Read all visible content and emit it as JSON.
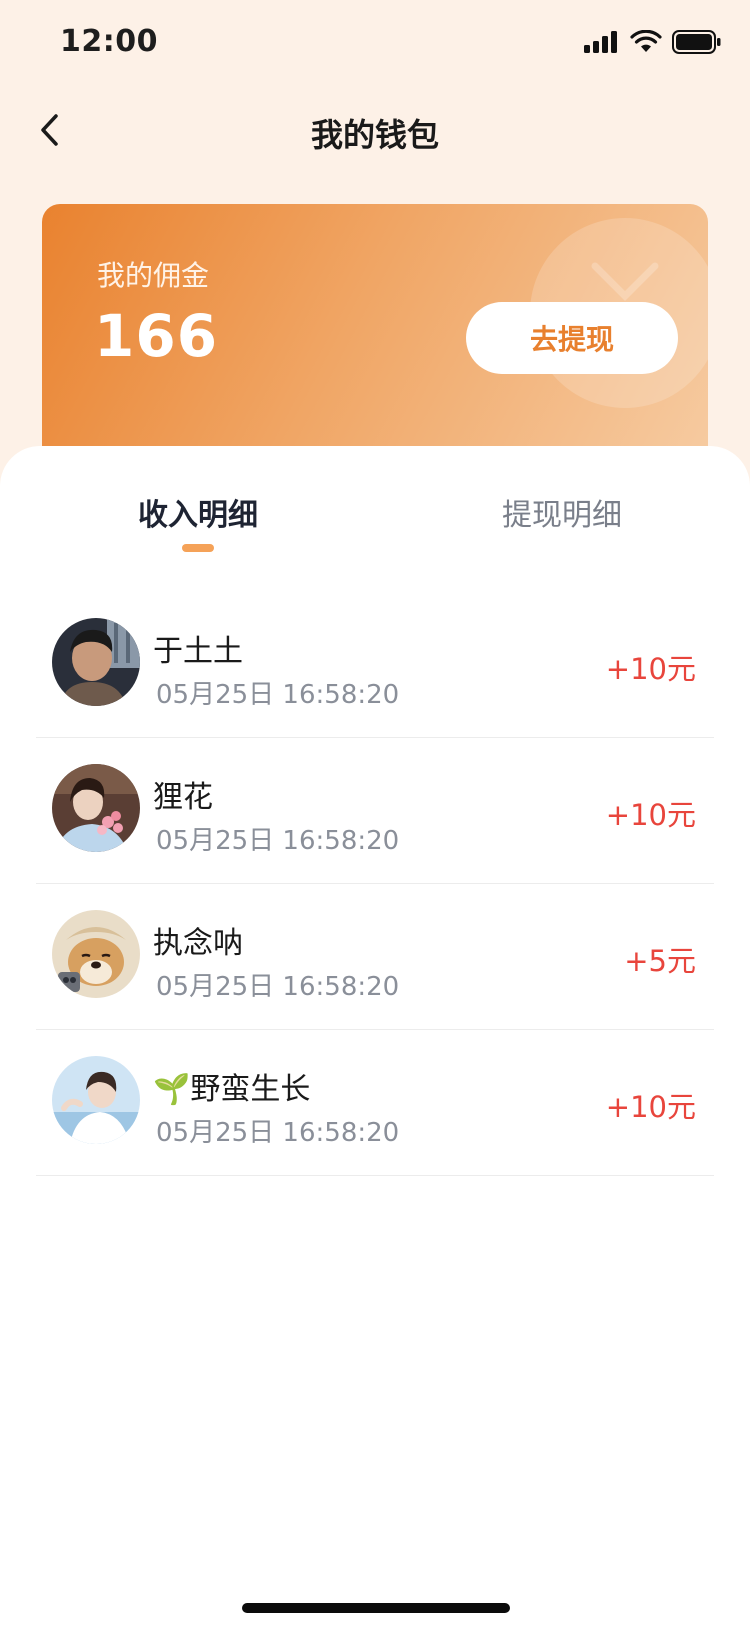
{
  "status_bar": {
    "time": "12:00"
  },
  "nav": {
    "title": "我的钱包"
  },
  "wallet": {
    "label": "我的佣金",
    "amount": "166",
    "withdraw_label": "去提现"
  },
  "tabs": [
    {
      "label": "收入明细",
      "active": true
    },
    {
      "label": "提现明细",
      "active": false
    }
  ],
  "records": [
    {
      "name": "于土土",
      "time": "05月25日 16:58:20",
      "amount": "+10元",
      "avatar": "avatar-boy-dark"
    },
    {
      "name": "狸花",
      "time": "05月25日 16:58:20",
      "amount": "+10元",
      "avatar": "avatar-girl-flowers"
    },
    {
      "name": "执念呐",
      "time": "05月25日 16:58:20",
      "amount": "+5元",
      "avatar": "avatar-shiba-dog"
    },
    {
      "name": "🌱野蛮生长",
      "time": "05月25日 16:58:20",
      "amount": "+10元",
      "avatar": "avatar-girl-beach"
    }
  ],
  "colors": {
    "accent": "#e8802e",
    "amount": "#e8453c",
    "page_bg": "#fdf1e7"
  }
}
